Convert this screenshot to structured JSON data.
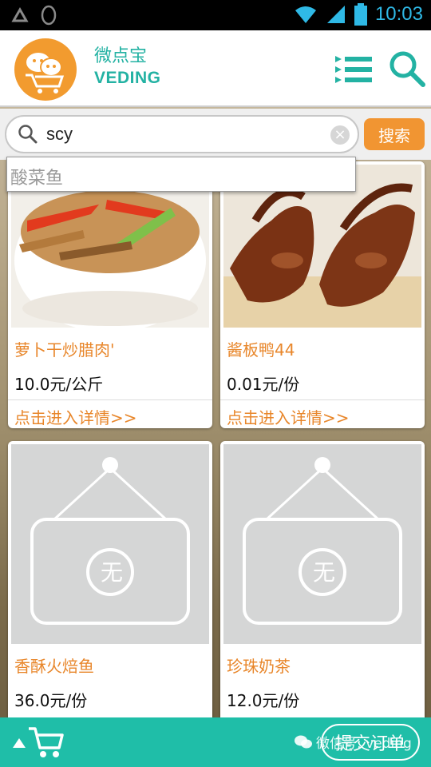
{
  "status_bar": {
    "time": "10:03",
    "icons": [
      "recycle-icon",
      "penguin-icon",
      "wifi-icon",
      "signal-icon",
      "battery-icon"
    ]
  },
  "header": {
    "brand_cn": "微点宝",
    "brand_en": "VEDING",
    "accent_color": "#23b2a3",
    "logo_color": "#f29b2f"
  },
  "search": {
    "value": "scy",
    "placeholder": "",
    "button_label": "搜索",
    "suggestion": "酸菜鱼"
  },
  "products": [
    {
      "name": "萝卜干炒腊肉'",
      "price": "10.0元/公斤",
      "detail_link": "点击进入详情>>",
      "image": "stir-fry-dish"
    },
    {
      "name": "酱板鸭44",
      "price": "0.01元/份",
      "detail_link": "点击进入详情>>",
      "image": "roast-duck"
    },
    {
      "name": "香酥火焙鱼",
      "price": "36.0元/份",
      "detail_link": "",
      "image": "placeholder"
    },
    {
      "name": "珍珠奶茶",
      "price": "12.0元/份",
      "detail_link": "",
      "image": "placeholder"
    }
  ],
  "bottom_bar": {
    "submit_label": "提交订单",
    "watermark": "微信号: veding",
    "bar_color": "#1fbea8",
    "action_color": "#f19532"
  }
}
